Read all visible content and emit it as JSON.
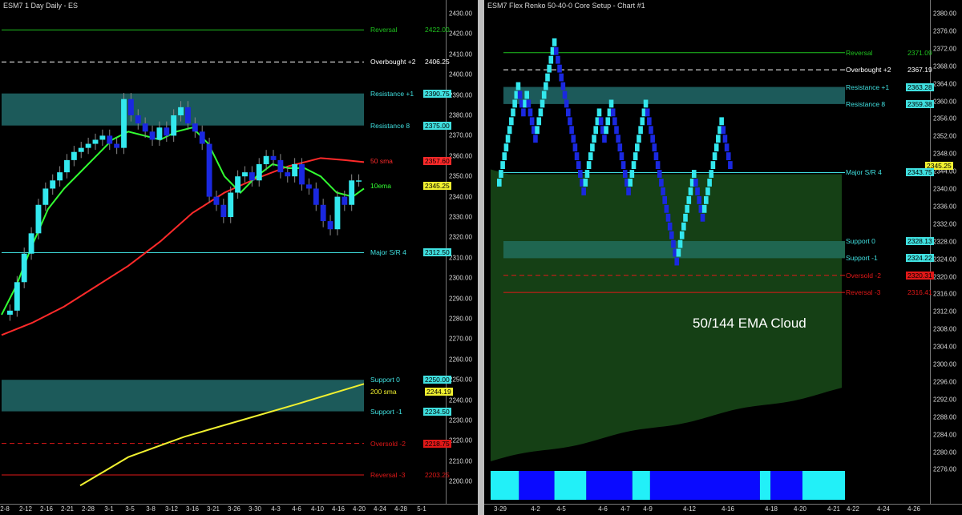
{
  "colors": {
    "background": "#000000",
    "up": "#33e8ee",
    "down": "#1a28e0",
    "green": "#1fc21f",
    "red": "#e01818",
    "zone": "#1c5a5a",
    "cloud": "#154015",
    "sma200": "#f0f030",
    "ema10": "#32ff32",
    "sma50": "#ff2a2a",
    "major": "#40e0e0"
  },
  "left": {
    "title": "ESM7 1 Day  Daily - ES",
    "price_axis": [
      "2430.00",
      "2420.00",
      "2410.00",
      "2400.00",
      "2390.00",
      "2380.00",
      "2370.00",
      "2360.00",
      "2350.00",
      "2340.00",
      "2330.00",
      "2320.00",
      "2310.00",
      "2300.00",
      "2290.00",
      "2280.00",
      "2270.00",
      "2260.00",
      "2250.00",
      "2240.00",
      "2230.00",
      "2220.00",
      "2210.00",
      "2200.00"
    ],
    "date_axis": [
      "2-8",
      "2-12",
      "2-16",
      "2-21",
      "2-28",
      "3-1",
      "3-5",
      "3-8",
      "3-12",
      "3-16",
      "3-21",
      "3-26",
      "3-30",
      "4-3",
      "4-6",
      "4-10",
      "4-16",
      "4-20",
      "4-24",
      "4-28",
      "5-1"
    ],
    "levels": [
      {
        "label": "Reversal",
        "value": "2422.00",
        "price": 2422,
        "color": "#1fc21f",
        "style": "solid"
      },
      {
        "label": "Overbought +2",
        "value": "2406.25",
        "price": 2406.25,
        "color": "#ffffff",
        "style": "dashed"
      },
      {
        "label": "Resistance +1",
        "value": "2390.75",
        "price": 2390.75,
        "color": "#40e0e0",
        "style": "none"
      },
      {
        "label": "Resistance 8",
        "value": "2375.00",
        "price": 2375,
        "color": "#40e0e0",
        "style": "none"
      },
      {
        "label": "50 sma",
        "value": "2357.60",
        "price": 2357.6,
        "color": "#ff2a2a",
        "style": "none"
      },
      {
        "label": "10ema",
        "value": "2345.25",
        "price": 2345.25,
        "color": "#32ff32",
        "style": "none"
      },
      {
        "label": "Major S/R 4",
        "value": "2312.50",
        "price": 2312.5,
        "color": "#40e0e0",
        "style": "solid"
      },
      {
        "label": "Support 0",
        "value": "2250.00",
        "price": 2250,
        "color": "#40e0e0",
        "style": "none"
      },
      {
        "label": "200 sma",
        "value": "2244.19",
        "price": 2244.19,
        "color": "#f0f030",
        "style": "none"
      },
      {
        "label": "Support -1",
        "value": "2234.50",
        "price": 2234.5,
        "color": "#40e0e0",
        "style": "none"
      },
      {
        "label": "Oversold -2",
        "value": "2218.75",
        "price": 2218.75,
        "color": "#e01818",
        "style": "dashed"
      },
      {
        "label": "Reversal -3",
        "value": "2203.25",
        "price": 2203.25,
        "color": "#e01818",
        "style": "solid"
      }
    ]
  },
  "right": {
    "title": "ESM7 Flex Renko 50-40-0 Core Setup - Chart #1",
    "cloud_label": "50/144 EMA Cloud",
    "price_axis": [
      "2380.00",
      "2376.00",
      "2372.00",
      "2368.00",
      "2364.00",
      "2360.00",
      "2356.00",
      "2352.00",
      "2348.00",
      "2344.00",
      "2340.00",
      "2336.00",
      "2332.00",
      "2328.00",
      "2324.00",
      "2320.00",
      "2316.00",
      "2312.00",
      "2308.00",
      "2304.00",
      "2300.00",
      "2296.00",
      "2292.00",
      "2288.00",
      "2284.00",
      "2280.00",
      "2276.00"
    ],
    "date_axis": [
      "3-29",
      "4-2",
      "4-5",
      "4-6",
      "4-7",
      "4-9",
      "4-12",
      "4-16",
      "4-18",
      "4-20",
      "4-21",
      "4-22",
      "4-24",
      "4-26"
    ],
    "levels": [
      {
        "label": "Reversal",
        "value": "2371.09",
        "price": 2371.09,
        "color": "#1fc21f",
        "style": "solid"
      },
      {
        "label": "Overbought +2",
        "value": "2367.19",
        "price": 2367.19,
        "color": "#ffffff",
        "style": "dashed"
      },
      {
        "label": "Resistance +1",
        "value": "2363.28",
        "price": 2363.28,
        "color": "#40e0e0",
        "style": "none"
      },
      {
        "label": "Resistance 8",
        "value": "2359.38",
        "price": 2359.38,
        "color": "#40e0e0",
        "style": "none"
      },
      {
        "label": "",
        "value": "2345.25",
        "price": 2345.25,
        "color": "#f0f030",
        "style": "none"
      },
      {
        "label": "Major S/R 4",
        "value": "2343.75",
        "price": 2343.75,
        "color": "#40e0e0",
        "style": "solid"
      },
      {
        "label": "Support 0",
        "value": "2328.13",
        "price": 2328.13,
        "color": "#40e0e0",
        "style": "none"
      },
      {
        "label": "Support -1",
        "value": "2324.22",
        "price": 2324.22,
        "color": "#40e0e0",
        "style": "none"
      },
      {
        "label": "Oversold -2",
        "value": "2320.31",
        "price": 2320.31,
        "color": "#e01818",
        "style": "dashed"
      },
      {
        "label": "Reversal -3",
        "value": "2316.41",
        "price": 2316.41,
        "color": "#e01818",
        "style": "solid"
      }
    ],
    "trend_strip": [
      {
        "state": "up",
        "from": 0,
        "to": 0.08
      },
      {
        "state": "down",
        "from": 0.08,
        "to": 0.18
      },
      {
        "state": "up",
        "from": 0.18,
        "to": 0.27
      },
      {
        "state": "down",
        "from": 0.27,
        "to": 0.4
      },
      {
        "state": "up",
        "from": 0.4,
        "to": 0.45
      },
      {
        "state": "down",
        "from": 0.45,
        "to": 0.76
      },
      {
        "state": "up",
        "from": 0.76,
        "to": 0.79
      },
      {
        "state": "down",
        "from": 0.79,
        "to": 0.88
      },
      {
        "state": "up",
        "from": 0.88,
        "to": 1.0
      }
    ]
  }
}
